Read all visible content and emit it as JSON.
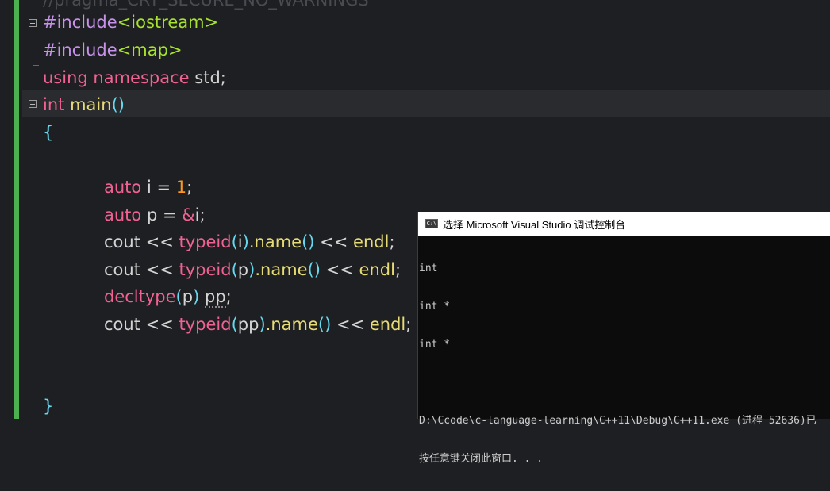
{
  "editor": {
    "top_partial": "//pragma_CRT_SECURE_NO_WARNINGS",
    "lines": {
      "l1": {
        "kw": "#include",
        "lib": "<iostream>"
      },
      "l2": {
        "kw": "#include",
        "lib": "<map>"
      },
      "l3": {
        "kw1": "using",
        "kw2": "namespace",
        "rest": "std;"
      },
      "l4": {
        "kw": "int",
        "fn": "main",
        "paren": "()"
      },
      "l5": {
        "brace_open": "{"
      },
      "l7": {
        "kw": "auto",
        "ident": "i",
        "op": "=",
        "num": "1",
        "semi": ";"
      },
      "l8": {
        "kw": "auto",
        "ident": "p",
        "op": "=",
        "amp": "&",
        "target": "i",
        "semi": ";"
      },
      "l9": {
        "cout": "cout",
        "shift": "<<",
        "typeid": "typeid",
        "op_paren": "(",
        "arg": "i",
        "cl_paren": ")",
        "dot_name": ".name",
        "call": "()",
        "shift2": "<<",
        "endl": "endl",
        "semi": ";"
      },
      "l10": {
        "cout": "cout",
        "shift": "<<",
        "typeid": "typeid",
        "op_paren": "(",
        "arg": "p",
        "cl_paren": ")",
        "dot_name": ".name",
        "call": "()",
        "shift2": "<<",
        "endl": "endl",
        "semi": ";"
      },
      "l11": {
        "kw": "decltype",
        "op_paren": "(",
        "arg": "p",
        "cl_paren": ")",
        "var": "pp",
        "semi": ";"
      },
      "l12": {
        "cout": "cout",
        "shift": "<<",
        "typeid": "typeid",
        "op_paren": "(",
        "arg": "pp",
        "cl_paren": ")",
        "dot_name": ".name",
        "call": "()",
        "shift2": "<<",
        "endl": "endl",
        "semi": ";"
      },
      "l15": {
        "brace_close": "}"
      }
    }
  },
  "console": {
    "icon_text": "C:\\",
    "title": "选择 Microsoft Visual Studio 调试控制台",
    "output": [
      "int",
      "int *",
      "int *",
      "",
      "D:\\Ccode\\c-language-learning\\C++11\\Debug\\C++11.exe (进程 52636)已",
      "按任意键关闭此窗口. . ."
    ]
  }
}
